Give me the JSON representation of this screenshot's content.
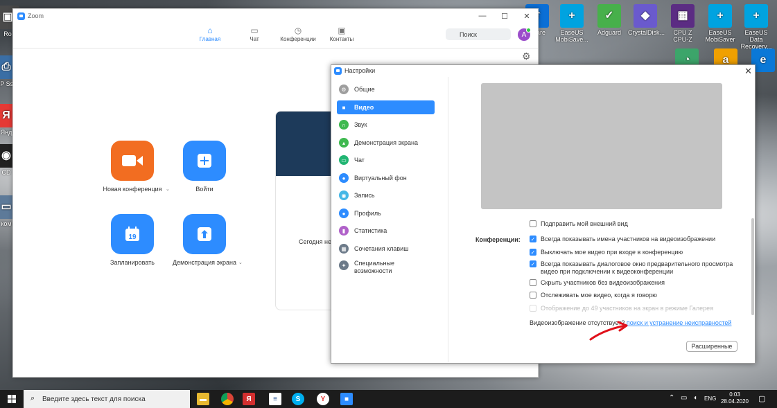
{
  "desktop_icons": [
    {
      "label": "Ro",
      "color": "#4a4a4a"
    },
    {
      "label": "HP Ssa",
      "color": "#3a6ea5"
    },
    {
      "label": "Янд",
      "color": "#e53935"
    },
    {
      "label": "CD",
      "color": "#222222"
    },
    {
      "label": "ком",
      "color": "#5d7a99"
    }
  ],
  "right_icons": [
    {
      "label": "Share",
      "color": "#0b6fd6"
    },
    {
      "label": "EaseUS MobiSave...",
      "color": "#00a3e0"
    },
    {
      "label": "Adguard",
      "color": "#47b04b"
    },
    {
      "label": "CrystalDisk...",
      "color": "#6a5acd"
    },
    {
      "label": "CPU Z CPU-Z",
      "color": "#5b2c83"
    },
    {
      "label": "EaseUS MobiSaver",
      "color": "#00a3e0"
    },
    {
      "label": "EaseUS Data Recovery...",
      "color": "#00a3e0"
    }
  ],
  "zoom": {
    "title": "Zoom",
    "nav": [
      {
        "label": "Главная",
        "icon": "home-icon"
      },
      {
        "label": "Чат",
        "icon": "chat-icon"
      },
      {
        "label": "Конференции",
        "icon": "clock-icon"
      },
      {
        "label": "Контакты",
        "icon": "contacts-icon"
      }
    ],
    "search_placeholder": "Поиск",
    "avatar_letter": "A",
    "actions": {
      "new_meeting": "Новая конференция",
      "join": "Войти",
      "schedule": "Запланировать",
      "schedule_day": "19",
      "share": "Демонстрация экрана"
    },
    "card_text": "Сегодня не"
  },
  "settings": {
    "title": "Настройки",
    "sidebar": [
      {
        "label": "Общие",
        "color": "#9e9e9e"
      },
      {
        "label": "Видео",
        "color": "#2d8cff"
      },
      {
        "label": "Звук",
        "color": "#3fb950"
      },
      {
        "label": "Демонстрация экрана",
        "color": "#3fb950"
      },
      {
        "label": "Чат",
        "color": "#22b573"
      },
      {
        "label": "Виртуальный фон",
        "color": "#2d8cff"
      },
      {
        "label": "Запись",
        "color": "#45b7e6"
      },
      {
        "label": "Профиль",
        "color": "#2d8cff"
      },
      {
        "label": "Статистика",
        "color": "#b061c9"
      },
      {
        "label": "Сочетания клавиш",
        "color": "#6c7a89"
      },
      {
        "label": "Специальные возможности",
        "color": "#6c7a89"
      }
    ],
    "conferences_label": "Конференции:",
    "options": [
      {
        "label": "Подправить мой внешний вид",
        "checked": false,
        "disabled": false
      },
      {
        "label": "Всегда показывать имена участников на видеоизображении",
        "checked": true,
        "disabled": false
      },
      {
        "label": "Выключать мое видео при входе в конференцию",
        "checked": true,
        "disabled": false
      },
      {
        "label": "Всегда показывать диалоговое окно предварительного просмотра видео при подключении к видеоконференции",
        "checked": true,
        "disabled": false
      },
      {
        "label": "Скрыть участников без видеоизображения",
        "checked": false,
        "disabled": false
      },
      {
        "label": "Отслеживать мое видео, когда я говорю",
        "checked": false,
        "disabled": false
      },
      {
        "label": "Отображение до 49 участников на экран в режиме Галерея",
        "checked": false,
        "disabled": true
      }
    ],
    "no_video_text": "Видеоизображение отсутствует?",
    "troubleshoot_link": "поиск и устранение неисправностей",
    "advanced_button": "Расширенные"
  },
  "taskbar": {
    "search_placeholder": "Введите здесь текст для поиска",
    "language": "ENG",
    "time": "0:03",
    "date": "28.04.2020"
  },
  "colors": {
    "accent": "#2d8cff",
    "orange": "#f26d21",
    "arrow": "#e0101a"
  }
}
